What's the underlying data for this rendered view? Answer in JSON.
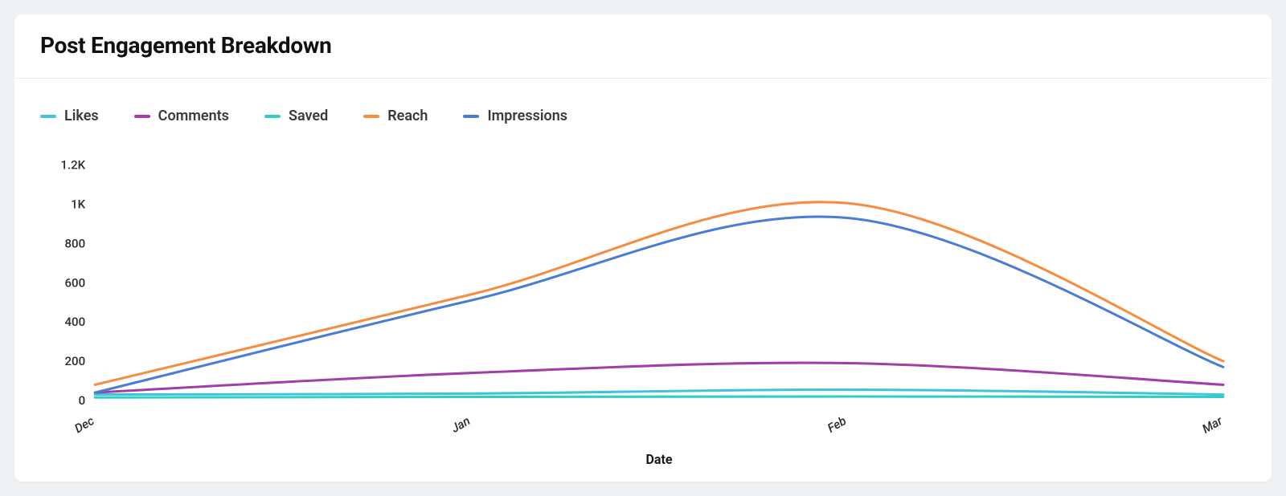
{
  "title": "Post Engagement Breakdown",
  "legend": [
    {
      "name": "Likes",
      "color": "#3fc4db"
    },
    {
      "name": "Comments",
      "color": "#a13fa8"
    },
    {
      "name": "Saved",
      "color": "#2fd0c1"
    },
    {
      "name": "Reach",
      "color": "#f68c3f"
    },
    {
      "name": "Impressions",
      "color": "#4a7cd6"
    }
  ],
  "chart_data": {
    "type": "line",
    "title": "Post Engagement Breakdown",
    "xlabel": "Date",
    "ylabel": "",
    "categories": [
      "Dec",
      "Jan",
      "Feb",
      "Mar"
    ],
    "ylim": [
      0,
      1200
    ],
    "yticks": [
      0,
      200,
      400,
      600,
      800,
      1000,
      1200
    ],
    "ytick_labels": [
      "0",
      "200",
      "400",
      "600",
      "800",
      "1K",
      "1.2K"
    ],
    "series": [
      {
        "name": "Likes",
        "color": "#3fc4db",
        "values": [
          30,
          35,
          55,
          30
        ]
      },
      {
        "name": "Comments",
        "color": "#a13fa8",
        "values": [
          40,
          140,
          190,
          80
        ]
      },
      {
        "name": "Saved",
        "color": "#2fd0c1",
        "values": [
          15,
          18,
          20,
          18
        ]
      },
      {
        "name": "Reach",
        "color": "#f68c3f",
        "values": [
          80,
          540,
          1005,
          200
        ]
      },
      {
        "name": "Impressions",
        "color": "#4a7cd6",
        "values": [
          40,
          510,
          930,
          170
        ]
      }
    ]
  }
}
